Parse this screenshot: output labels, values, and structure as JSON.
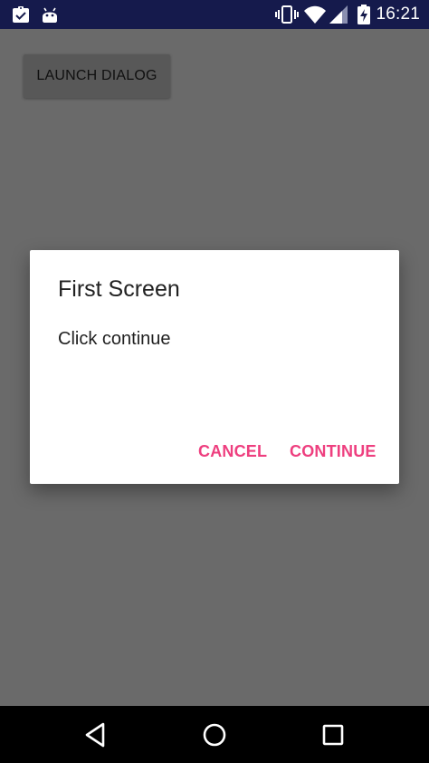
{
  "status_bar": {
    "time": "16:21",
    "icons": [
      "clipboard-check-icon",
      "android-icon",
      "vibrate-icon",
      "wifi-icon",
      "signal-icon",
      "battery-charging-icon"
    ],
    "background_color": "#151a4c"
  },
  "main": {
    "launch_button_label": "LAUNCH DIALOG"
  },
  "dialog": {
    "title": "First Screen",
    "message": "Click continue",
    "cancel_label": "CANCEL",
    "continue_label": "CONTINUE",
    "accent_color": "#ee3f7f"
  },
  "nav_bar": {
    "icons": [
      "back-icon",
      "home-icon",
      "recents-icon"
    ]
  }
}
